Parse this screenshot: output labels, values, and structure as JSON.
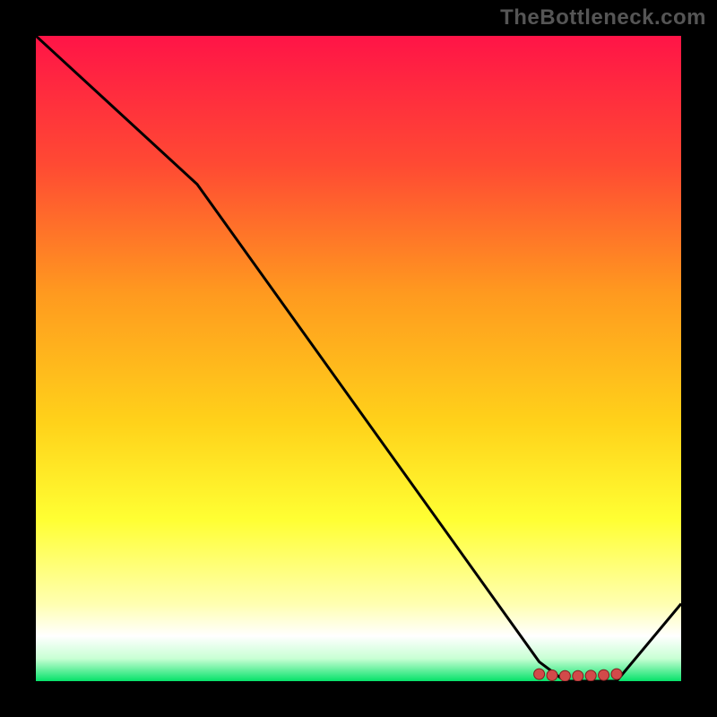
{
  "watermark": "TheBottleneck.com",
  "colors": {
    "bg": "#000000",
    "line": "#000000",
    "marker_fill": "#d24a4a",
    "marker_stroke": "#802020",
    "gradient_stops": [
      {
        "offset": 0.0,
        "color": "#ff1447"
      },
      {
        "offset": 0.2,
        "color": "#ff4a33"
      },
      {
        "offset": 0.4,
        "color": "#ff9a1f"
      },
      {
        "offset": 0.6,
        "color": "#ffd21a"
      },
      {
        "offset": 0.75,
        "color": "#ffff33"
      },
      {
        "offset": 0.88,
        "color": "#ffffb0"
      },
      {
        "offset": 0.93,
        "color": "#ffffff"
      },
      {
        "offset": 0.965,
        "color": "#c8ffd4"
      },
      {
        "offset": 1.0,
        "color": "#06e26a"
      }
    ]
  },
  "chart_data": {
    "type": "line",
    "title": "",
    "xlabel": "",
    "ylabel": "",
    "xlim": [
      0,
      100
    ],
    "ylim": [
      0,
      100
    ],
    "x": [
      0,
      25,
      78,
      82,
      90,
      100
    ],
    "values": [
      100,
      77,
      3,
      0,
      0,
      12
    ],
    "markers": {
      "x": [
        78,
        80,
        82,
        84,
        86,
        88,
        90
      ],
      "y": [
        1.1,
        0.9,
        0.8,
        0.8,
        0.85,
        0.95,
        1.1
      ]
    }
  }
}
